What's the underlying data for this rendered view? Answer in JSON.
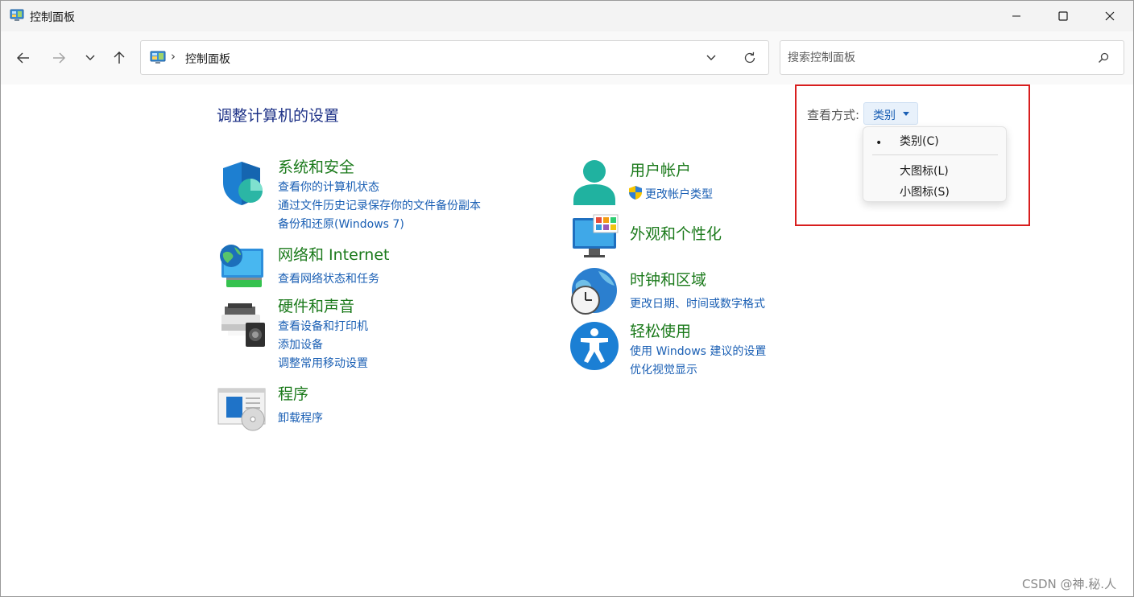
{
  "window": {
    "title": "控制面板"
  },
  "nav": {
    "breadcrumb_separator": "›",
    "address_text": "控制面板",
    "search_placeholder": "搜索控制面板"
  },
  "main": {
    "page_title": "调整计算机的设置",
    "left_categories": [
      {
        "title": "系统和安全",
        "icon": "shield-icon",
        "links": [
          "查看你的计算机状态",
          "通过文件历史记录保存你的文件备份副本",
          "备份和还原(Windows 7)"
        ]
      },
      {
        "title": "网络和 Internet",
        "icon": "network-globe-icon",
        "links": [
          "查看网络状态和任务"
        ]
      },
      {
        "title": "硬件和声音",
        "icon": "printer-speaker-icon",
        "links": [
          "查看设备和打印机",
          "添加设备",
          "调整常用移动设置"
        ]
      },
      {
        "title": "程序",
        "icon": "programs-disc-icon",
        "links": [
          "卸载程序"
        ]
      }
    ],
    "right_categories": [
      {
        "title": "用户帐户",
        "icon": "user-icon",
        "links": [
          "更改帐户类型"
        ]
      },
      {
        "title": "外观和个性化",
        "icon": "monitor-palette-icon",
        "links": []
      },
      {
        "title": "时钟和区域",
        "icon": "globe-clock-icon",
        "links": [
          "更改日期、时间或数字格式"
        ]
      },
      {
        "title": "轻松使用",
        "icon": "accessibility-icon",
        "links": [
          "使用 Windows 建议的设置",
          "优化视觉显示"
        ]
      }
    ]
  },
  "view_by": {
    "label": "查看方式:",
    "selected": "类别",
    "options": [
      "类别(C)",
      "大图标(L)",
      "小图标(S)"
    ],
    "bullet": "•"
  },
  "colors": {
    "category_title": "#1b7a1b",
    "link": "#1a5fb4",
    "page_title": "#1e3287",
    "highlight": "#d81e1e"
  },
  "watermark": "CSDN @神.秘.人"
}
